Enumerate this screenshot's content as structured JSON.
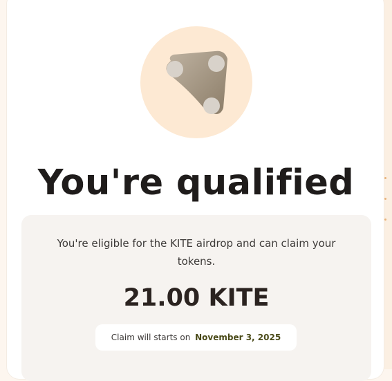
{
  "header": {
    "title": "You're qualified"
  },
  "logo": {
    "icon": "kite-logo-icon",
    "circle_color": "#fde9d3",
    "shape_color": "#a99a86",
    "dot_color": "#d8d2ca"
  },
  "eligibility": {
    "description": "You're eligible for the KITE airdrop and can claim your tokens.",
    "amount": "21.00 KITE"
  },
  "claim": {
    "prefix": "Claim will starts on",
    "date": "November 3, 2025"
  },
  "colors": {
    "background": "#fdf6ef",
    "card": "#ffffff",
    "info_box": "#f6f3f0",
    "title": "#1f1c1b",
    "date_accent": "#4a4a18"
  }
}
